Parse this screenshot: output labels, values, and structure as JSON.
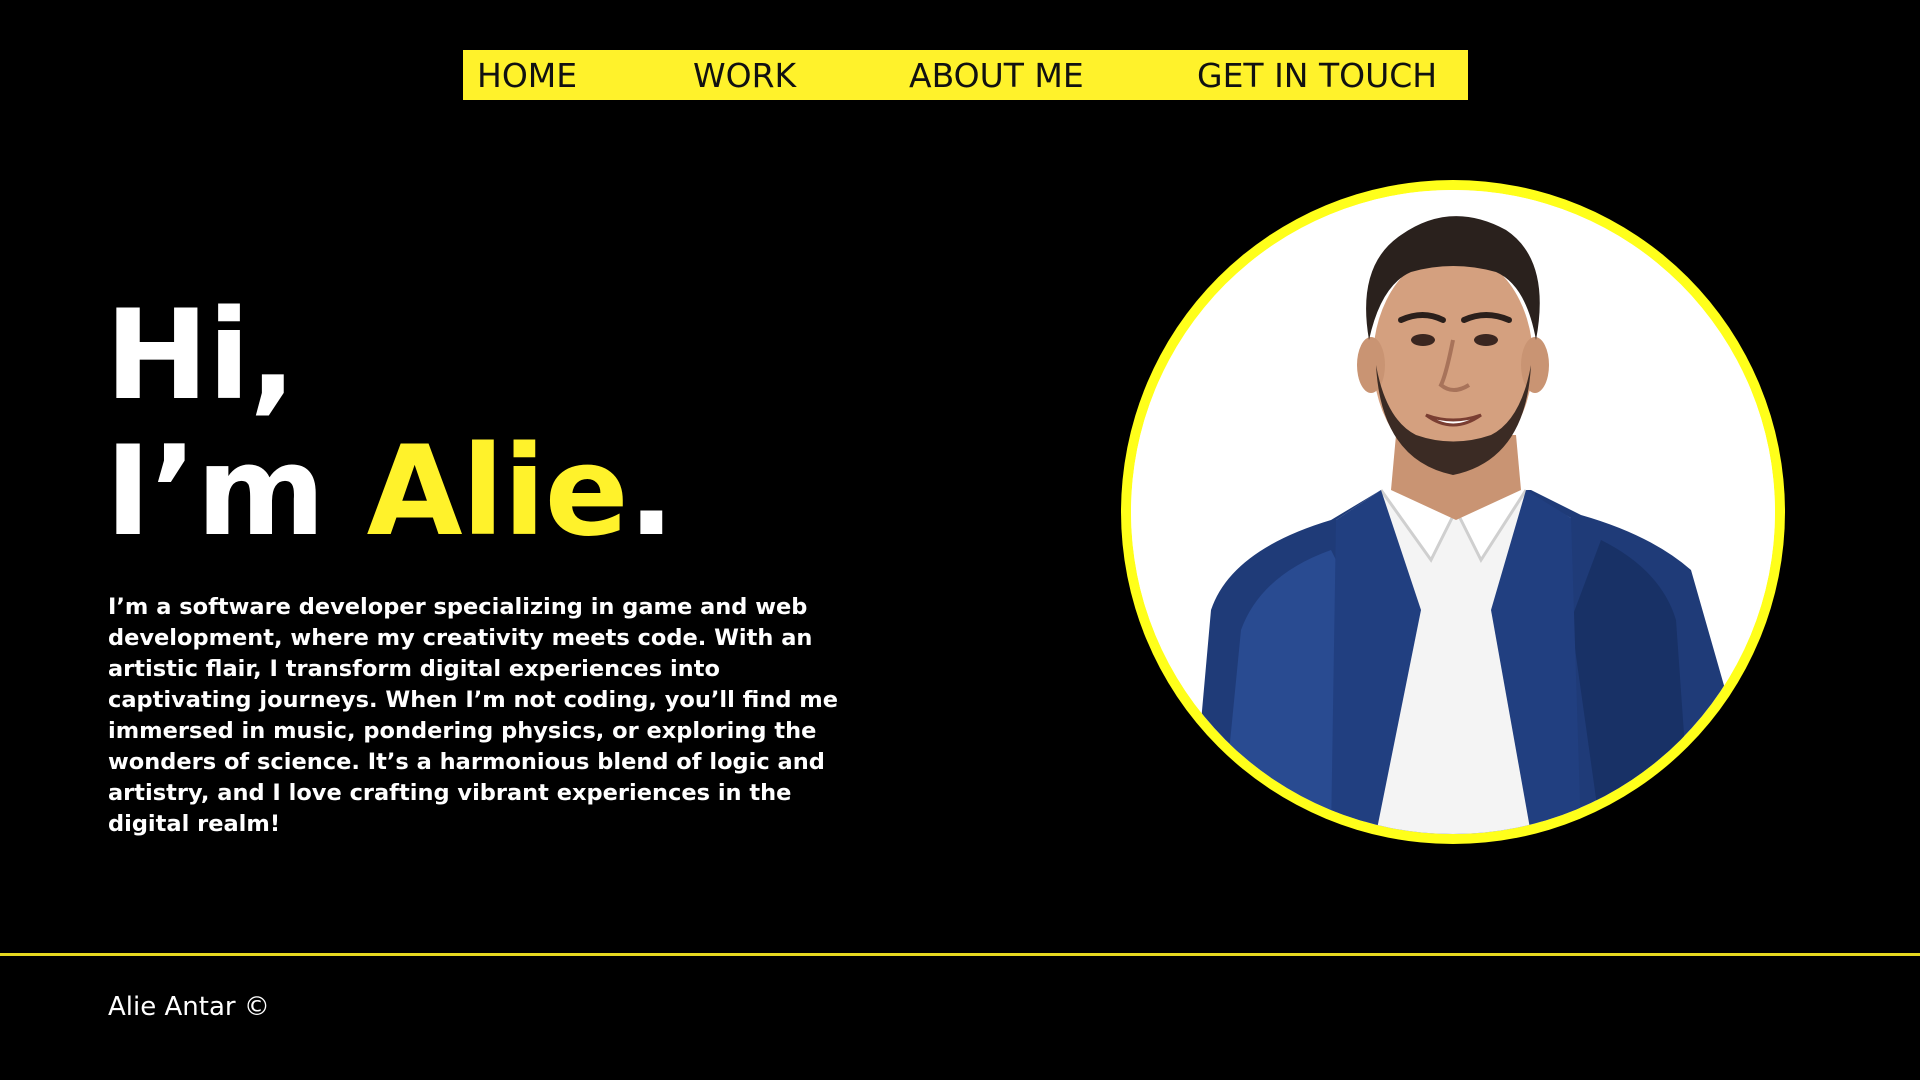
{
  "colors": {
    "background": "#000000",
    "accent": "#fff22b",
    "text": "#ffffff",
    "nav_text": "#111111",
    "footer_divider": "#e6d81f"
  },
  "nav": {
    "items": [
      {
        "label": "HOME"
      },
      {
        "label": "WORK"
      },
      {
        "label": "ABOUT ME"
      },
      {
        "label": "GET IN TOUCH"
      }
    ]
  },
  "hero": {
    "greeting": "Hi,",
    "intro_prefix": "I’m ",
    "name": "Alie",
    "intro_suffix": ".",
    "bio": "I’m a software developer specializing in game and web development, where my creativity meets code. With an artistic flair, I transform digital experiences into captivating journeys. When I’m not coding, you’ll find me immersed in music, pondering physics, or exploring the wonders of science. It’s a harmonious blend of logic and artistry, and I love crafting vibrant experiences in the digital realm!"
  },
  "portrait": {
    "icon": "profile-photo"
  },
  "footer": {
    "copyright": "Alie Antar ©"
  }
}
